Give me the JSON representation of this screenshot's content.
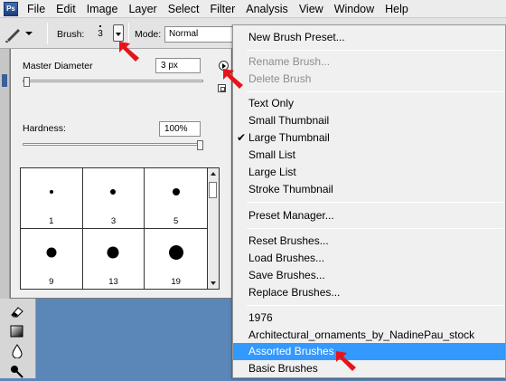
{
  "menubar": {
    "logo": "Ps",
    "items": [
      "File",
      "Edit",
      "Image",
      "Layer",
      "Select",
      "Filter",
      "Analysis",
      "View",
      "Window",
      "Help"
    ]
  },
  "options_bar": {
    "brush_label": "Brush:",
    "brush_size": "3",
    "mode_label": "Mode:",
    "mode_value": "Normal"
  },
  "brush_picker": {
    "master_diameter_label": "Master Diameter",
    "master_diameter_value": "3 px",
    "master_diameter_fraction": 0.005,
    "hardness_label": "Hardness:",
    "hardness_value": "100%",
    "hardness_fraction": 1.0,
    "brushes": [
      {
        "size": "1"
      },
      {
        "size": "3"
      },
      {
        "size": "5"
      },
      {
        "size": "9"
      },
      {
        "size": "13"
      },
      {
        "size": "19"
      }
    ]
  },
  "context_menu": {
    "items": [
      {
        "label": "New Brush Preset...",
        "disabled": false,
        "checked": false,
        "highlighted": false
      },
      {
        "label": "Rename Brush...",
        "disabled": true,
        "checked": false,
        "highlighted": false
      },
      {
        "label": "Delete Brush",
        "disabled": true,
        "checked": false,
        "highlighted": false
      },
      {
        "label": "Text Only",
        "disabled": false,
        "checked": false,
        "highlighted": false
      },
      {
        "label": "Small Thumbnail",
        "disabled": false,
        "checked": false,
        "highlighted": false
      },
      {
        "label": "Large Thumbnail",
        "disabled": false,
        "checked": true,
        "highlighted": false
      },
      {
        "label": "Small List",
        "disabled": false,
        "checked": false,
        "highlighted": false
      },
      {
        "label": "Large List",
        "disabled": false,
        "checked": false,
        "highlighted": false
      },
      {
        "label": "Stroke Thumbnail",
        "disabled": false,
        "checked": false,
        "highlighted": false
      },
      {
        "label": "Preset Manager...",
        "disabled": false,
        "checked": false,
        "highlighted": false
      },
      {
        "label": "Reset Brushes...",
        "disabled": false,
        "checked": false,
        "highlighted": false
      },
      {
        "label": "Load Brushes...",
        "disabled": false,
        "checked": false,
        "highlighted": false
      },
      {
        "label": "Save Brushes...",
        "disabled": false,
        "checked": false,
        "highlighted": false
      },
      {
        "label": "Replace Brushes...",
        "disabled": false,
        "checked": false,
        "highlighted": false
      },
      {
        "label": "1976",
        "disabled": false,
        "checked": false,
        "highlighted": false
      },
      {
        "label": "Architectural_ornaments_by_NadinePau_stock",
        "disabled": false,
        "checked": false,
        "highlighted": false
      },
      {
        "label": "Assorted Brushes",
        "disabled": false,
        "checked": false,
        "highlighted": true
      },
      {
        "label": "Basic Brushes",
        "disabled": false,
        "checked": false,
        "highlighted": false
      }
    ],
    "check_mark": "✔"
  },
  "colors": {
    "highlight": "#3399ff",
    "canvas_background": "#5b87b8",
    "annotation_arrow": "#e8131a"
  }
}
